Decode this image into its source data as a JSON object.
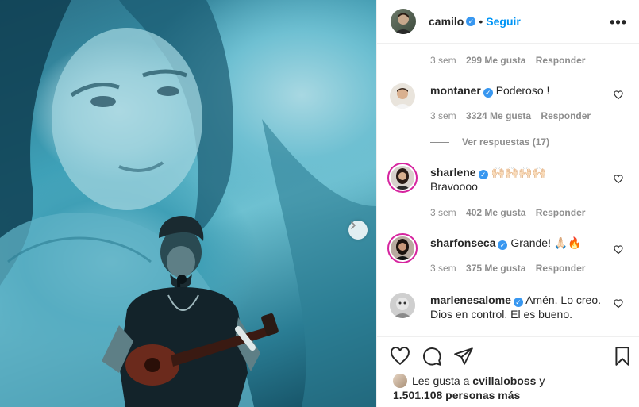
{
  "post": {
    "username": "camilo",
    "follow_label": "Seguir",
    "separator": "•",
    "more_label": "•••"
  },
  "comments": [
    {
      "age": "3 sem",
      "likes": "299 Me gusta",
      "reply": "Responder"
    },
    {
      "username": "montaner",
      "text": "Poderoso !",
      "age": "3 sem",
      "likes": "3324 Me gusta",
      "reply": "Responder",
      "view_replies": "Ver respuestas (17)"
    },
    {
      "username": "sharlene",
      "emoji": "🙌🏻🙌🏻🙌🏻🙌🏻",
      "text": "Bravoooo",
      "age": "3 sem",
      "likes": "402 Me gusta",
      "reply": "Responder"
    },
    {
      "username": "sharfonseca",
      "text": "Grande! 🙏🏻🔥",
      "age": "3 sem",
      "likes": "375 Me gusta",
      "reply": "Responder"
    },
    {
      "username": "marlenesalome",
      "text": "Amén. Lo creo. Dios en control. El es bueno."
    }
  ],
  "likes": {
    "prefix": "Les gusta a",
    "liker": "cvillaloboss",
    "conj": "y",
    "count": "1.501.108 personas más"
  },
  "icons": [
    "heart-icon",
    "comment-icon",
    "share-icon",
    "bookmark-icon",
    "chevron-right-icon",
    "verified-icon",
    "more-icon"
  ],
  "colors": {
    "link": "#0095f6",
    "verified": "#3897f0",
    "muted": "#8e8e8e",
    "text": "#262626"
  }
}
